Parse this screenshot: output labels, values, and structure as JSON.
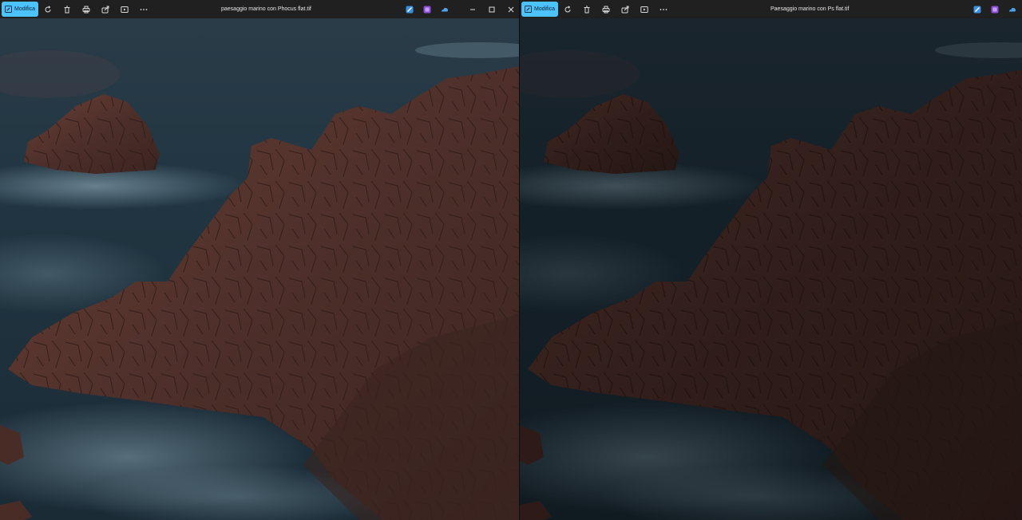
{
  "windows": [
    {
      "edit_label": "Modifica",
      "title": "paesaggio marino con Phocus flat.tif"
    },
    {
      "edit_label": "Modifica",
      "title": "Paesaggio marino con  Ps flat.tif"
    }
  ],
  "colors": {
    "accent": "#4cc2ff",
    "toolbar": "#202020",
    "sea": "#1d3440",
    "rock": "#5a3530"
  },
  "icons": [
    "edit-icon",
    "rotate-icon",
    "delete-icon",
    "print-icon",
    "share-icon",
    "slideshow-icon",
    "more-icon",
    "clipchamp-icon",
    "designer-icon",
    "onedrive-icon",
    "minimize-icon",
    "maximize-icon",
    "close-icon"
  ]
}
